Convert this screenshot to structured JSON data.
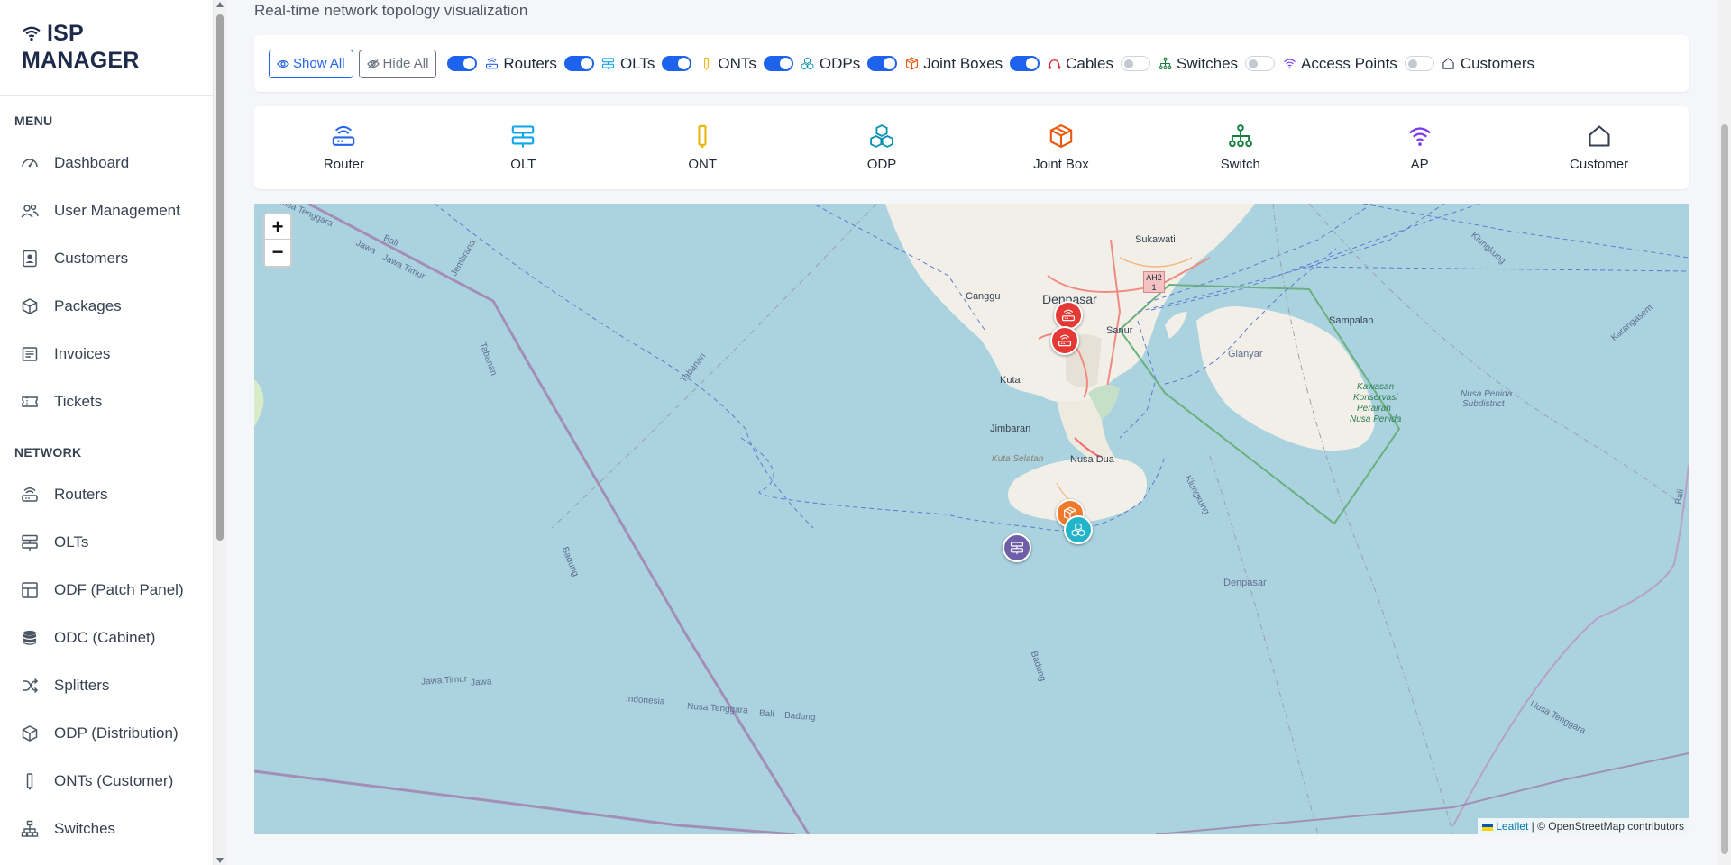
{
  "brand": {
    "line1": "ISP",
    "line2": "MANAGER"
  },
  "sidebar": {
    "menu_label": "MENU",
    "menu_items": [
      {
        "label": "Dashboard",
        "icon": "speedometer-icon"
      },
      {
        "label": "User Management",
        "icon": "users-icon"
      },
      {
        "label": "Customers",
        "icon": "contact-card-icon"
      },
      {
        "label": "Packages",
        "icon": "box-icon"
      },
      {
        "label": "Invoices",
        "icon": "invoice-icon"
      },
      {
        "label": "Tickets",
        "icon": "ticket-icon"
      }
    ],
    "network_label": "NETWORK",
    "network_items": [
      {
        "label": "Routers",
        "icon": "router-icon"
      },
      {
        "label": "OLTs",
        "icon": "olt-icon"
      },
      {
        "label": "ODF (Patch Panel)",
        "icon": "patch-panel-icon"
      },
      {
        "label": "ODC (Cabinet)",
        "icon": "database-icon"
      },
      {
        "label": "Splitters",
        "icon": "shuffle-icon"
      },
      {
        "label": "ODP (Distribution)",
        "icon": "box-icon"
      },
      {
        "label": "ONTs (Customer)",
        "icon": "ont-icon"
      },
      {
        "label": "Switches",
        "icon": "network-icon"
      }
    ]
  },
  "page": {
    "subtitle": "Real-time network topology visualization"
  },
  "toolbar": {
    "show_all": "Show All",
    "hide_all": "Hide All",
    "layers": [
      {
        "label": "Routers",
        "on": true,
        "icon": "router-icon",
        "color": "#2563eb"
      },
      {
        "label": "OLTs",
        "on": true,
        "icon": "olt-icon",
        "color": "#0ea5e9"
      },
      {
        "label": "ONTs",
        "on": true,
        "icon": "ont-icon",
        "color": "#eab308"
      },
      {
        "label": "ODPs",
        "on": true,
        "icon": "odp-icon",
        "color": "#0891b2"
      },
      {
        "label": "Joint Boxes",
        "on": true,
        "icon": "joint-box-icon",
        "color": "#ea580c"
      },
      {
        "label": "Cables",
        "on": true,
        "icon": "cable-icon",
        "color": "#dc2626"
      },
      {
        "label": "Switches",
        "on": false,
        "icon": "switch-icon",
        "color": "#15803d"
      },
      {
        "label": "Access Points",
        "on": false,
        "icon": "wifi-icon",
        "color": "#7c3aed"
      },
      {
        "label": "Customers",
        "on": false,
        "icon": "home-icon",
        "color": "#374151"
      }
    ]
  },
  "legend": [
    {
      "label": "Router",
      "icon": "router-icon",
      "color": "#2563eb"
    },
    {
      "label": "OLT",
      "icon": "olt-icon",
      "color": "#0ea5e9"
    },
    {
      "label": "ONT",
      "icon": "ont-icon",
      "color": "#eab308"
    },
    {
      "label": "ODP",
      "icon": "odp-icon",
      "color": "#0891b2"
    },
    {
      "label": "Joint Box",
      "icon": "joint-box-icon",
      "color": "#ea580c"
    },
    {
      "label": "Switch",
      "icon": "switch-icon",
      "color": "#15803d"
    },
    {
      "label": "AP",
      "icon": "wifi-icon",
      "color": "#7c3aed"
    },
    {
      "label": "Customer",
      "icon": "home-icon",
      "color": "#374151"
    }
  ],
  "map": {
    "zoom_in": "+",
    "zoom_out": "−",
    "attribution_leaflet": "Leaflet",
    "attribution_rest": "| © OpenStreetMap contributors",
    "labels": {
      "sukawati": "Sukawati",
      "ah2": "AH2",
      "ah2_num": "1",
      "canggu": "Canggu",
      "denpasar_city": "Denpasar",
      "sanur": "Sanur",
      "gianyar": "Gianyar",
      "kuta": "Kuta",
      "jimbaran": "Jimbaran",
      "kuta_selatan": "Kuta Selatan",
      "nusa_dua": "Nusa Dua",
      "sampalan": "Sampalan",
      "kawasan": "Kawasan",
      "konservasi": "Konservasi",
      "perairan": "Perairan",
      "nusa_penida": "Nusa Penida",
      "nusa_penida_sub": "Nusa Penida",
      "subdistrict": "Subdistrict",
      "denpasar_sea": "Denpasar",
      "nusa_tenggara_1": "Nusa Tenggara",
      "bali_1": "Bali",
      "jawa_1": "Jawa",
      "jawa_timur_1": "Jawa Timur",
      "jembrana": "Jembrana",
      "tabanan_1": "Tabanan",
      "tabanan_2": "Tabanan",
      "badung_1": "Badung",
      "badung_2": "Badung",
      "klungkung_1": "Klungkung",
      "klungkung_2": "Klungkung",
      "karangasem": "Karangasem",
      "jawa_timur_2": "Jawa Timur",
      "jawa_2": "Jawa",
      "indonesia": "Indonesia",
      "nusa_tenggara_2": "Nusa Tenggara",
      "bali_2": "Bali",
      "badung_3": "Badung",
      "nusa_tenggara_3": "Nusa Tenggara",
      "bali_3": "Bali"
    },
    "markers": [
      {
        "type": "router",
        "icon": "router-icon",
        "color": "#e53935"
      },
      {
        "type": "router",
        "icon": "router-icon",
        "color": "#e53935"
      },
      {
        "type": "joint-box",
        "icon": "joint-box-icon",
        "color": "#f07a2a"
      },
      {
        "type": "odp",
        "icon": "odp-icon",
        "color": "#22b5c9"
      },
      {
        "type": "olt",
        "icon": "olt-icon",
        "color": "#6e5ea8"
      }
    ]
  }
}
